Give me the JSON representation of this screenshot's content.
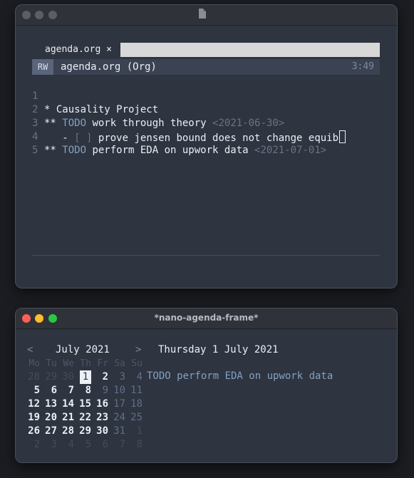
{
  "editor_window": {
    "tab_label": "agenda.org ×",
    "modeline": {
      "state": "RW",
      "title": "agenda.org (Org)",
      "time": "3:49"
    },
    "lines": [
      {
        "num": "1",
        "stars": "* ",
        "keyword": "",
        "text": "Causality Project",
        "date": ""
      },
      {
        "num": "2",
        "stars": "** ",
        "keyword": "TODO",
        "text": " work through theory ",
        "date": "<2021-06-30>"
      },
      {
        "num": "3",
        "stars": "",
        "keyword": "",
        "text": "prove jensen bound does not change equib",
        "date": "",
        "bullet": "   - ",
        "checkbox": "[ ]"
      },
      {
        "num": "4",
        "stars": "** ",
        "keyword": "TODO",
        "text": " perform EDA on upwork data ",
        "date": "<2021-07-01>"
      },
      {
        "num": "5",
        "stars": "",
        "keyword": "",
        "text": "",
        "date": ""
      }
    ]
  },
  "agenda_window": {
    "title": "*nano-agenda-frame*",
    "calendar": {
      "prev": "<",
      "next": ">",
      "month_label": "July 2021",
      "weekdays": [
        "Mo",
        "Tu",
        "We",
        "Th",
        "Fr",
        "Sa",
        "Su"
      ],
      "weeks": [
        [
          {
            "d": "28",
            "t": "oth"
          },
          {
            "d": "29",
            "t": "oth"
          },
          {
            "d": "30",
            "t": "oth"
          },
          {
            "d": "1",
            "t": "today"
          },
          {
            "d": "2",
            "t": "cur"
          },
          {
            "d": "3",
            "t": "we"
          },
          {
            "d": "4",
            "t": "we"
          }
        ],
        [
          {
            "d": "5",
            "t": "cur"
          },
          {
            "d": "6",
            "t": "cur"
          },
          {
            "d": "7",
            "t": "cur"
          },
          {
            "d": "8",
            "t": "cur"
          },
          {
            "d": "9",
            "t": "we"
          },
          {
            "d": "10",
            "t": "we"
          },
          {
            "d": "11",
            "t": "we"
          }
        ],
        [
          {
            "d": "12",
            "t": "cur"
          },
          {
            "d": "13",
            "t": "cur"
          },
          {
            "d": "14",
            "t": "cur"
          },
          {
            "d": "15",
            "t": "cur"
          },
          {
            "d": "16",
            "t": "cur"
          },
          {
            "d": "17",
            "t": "we"
          },
          {
            "d": "18",
            "t": "we"
          }
        ],
        [
          {
            "d": "19",
            "t": "cur"
          },
          {
            "d": "20",
            "t": "cur"
          },
          {
            "d": "21",
            "t": "cur"
          },
          {
            "d": "22",
            "t": "cur"
          },
          {
            "d": "23",
            "t": "cur"
          },
          {
            "d": "24",
            "t": "we"
          },
          {
            "d": "25",
            "t": "we"
          }
        ],
        [
          {
            "d": "26",
            "t": "cur"
          },
          {
            "d": "27",
            "t": "cur"
          },
          {
            "d": "28",
            "t": "cur"
          },
          {
            "d": "29",
            "t": "cur"
          },
          {
            "d": "30",
            "t": "cur"
          },
          {
            "d": "31",
            "t": "we"
          },
          {
            "d": "1",
            "t": "oth"
          }
        ],
        [
          {
            "d": "2",
            "t": "oth"
          },
          {
            "d": "3",
            "t": "oth"
          },
          {
            "d": "4",
            "t": "oth"
          },
          {
            "d": "5",
            "t": "oth"
          },
          {
            "d": "6",
            "t": "oth"
          },
          {
            "d": "7",
            "t": "oth"
          },
          {
            "d": "8",
            "t": "oth"
          }
        ]
      ]
    },
    "selected_date": "Thursday 1 July 2021",
    "entries": [
      "TODO perform EDA on upwork data"
    ]
  },
  "colors": {
    "background": "#2e3440",
    "foreground": "#eceff4",
    "todo": "#81a1c1",
    "faded": "#6b7385",
    "today_highlight": "#eceff4"
  }
}
